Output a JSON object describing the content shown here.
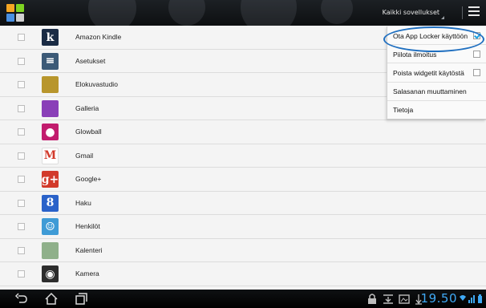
{
  "action_bar": {
    "filter_label": "Kaikki sovellukset",
    "app_icon": "app-locker-icon",
    "overflow_icon": "overflow-menu-icon"
  },
  "apps": [
    {
      "name": "Amazon Kindle",
      "icon": "kindle-icon",
      "icon_color": "#1a2b44",
      "glyph": "k"
    },
    {
      "name": "Asetukset",
      "icon": "settings-icon",
      "icon_color": "#3c5a77",
      "glyph": "≡"
    },
    {
      "name": "Elokuvastudio",
      "icon": "clapperboard-icon",
      "icon_color": "#b8962c",
      "glyph": ""
    },
    {
      "name": "Galleria",
      "icon": "gallery-icon",
      "icon_color": "#8a3fb8",
      "glyph": ""
    },
    {
      "name": "Glowball",
      "icon": "glowball-icon",
      "icon_color": "#c21c6e",
      "glyph": "●"
    },
    {
      "name": "Gmail",
      "icon": "gmail-icon",
      "icon_color": "#ffffff",
      "glyph": "M"
    },
    {
      "name": "Google+",
      "icon": "google-plus-icon",
      "icon_color": "#d23a2b",
      "glyph": "g+"
    },
    {
      "name": "Haku",
      "icon": "search-icon",
      "icon_color": "#2a62c9",
      "glyph": "8"
    },
    {
      "name": "Henkilöt",
      "icon": "contacts-icon",
      "icon_color": "#3f9bd6",
      "glyph": "☺"
    },
    {
      "name": "Kalenteri",
      "icon": "calendar-icon",
      "icon_color": "#8fb08a",
      "glyph": ""
    },
    {
      "name": "Kamera",
      "icon": "camera-icon",
      "icon_color": "#2d2d2d",
      "glyph": "◉"
    },
    {
      "name": "",
      "icon": "clock-icon",
      "icon_color": "#222222",
      "glyph": ""
    }
  ],
  "menu": {
    "items": [
      {
        "label": "Ota App Locker käyttöön",
        "checkbox": true,
        "checked": true
      },
      {
        "label": "Piilota ilmoitus",
        "checkbox": true,
        "checked": false
      },
      {
        "label": "Poista widgetit käytöstä",
        "checkbox": true,
        "checked": false
      },
      {
        "label": "Salasanan muuttaminen",
        "checkbox": false,
        "checked": false
      },
      {
        "label": "Tietoja",
        "checkbox": false,
        "checked": false
      }
    ]
  },
  "system_bar": {
    "time": "19.50",
    "accent_color": "#3fa9f5",
    "nav_icons": [
      "back-icon",
      "home-icon",
      "recent-apps-icon"
    ],
    "status_icons": [
      "lock-icon",
      "download-tray-icon",
      "screenshot-icon",
      "usb-icon",
      "wifi-icon",
      "signal-icon",
      "battery-icon"
    ]
  }
}
